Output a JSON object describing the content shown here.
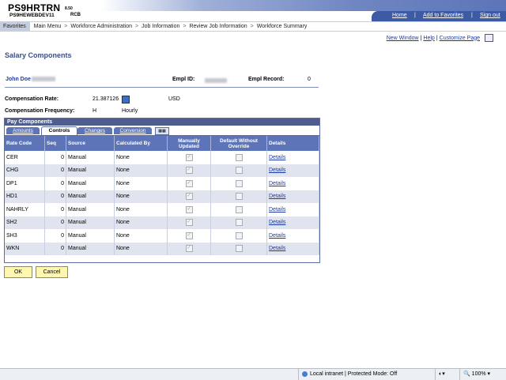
{
  "header": {
    "db_name": "PS9HRTRN",
    "db_version": "8.50",
    "server_name": "PS9HEWEBDEV11",
    "server_tag": "RCB",
    "links": [
      "Home",
      "Add to Favorites",
      "Sign out"
    ]
  },
  "breadcrumb": [
    "Favorites",
    "Main Menu",
    "Workforce Administration",
    "Job Information",
    "Review Job Information",
    "Workforce Summary"
  ],
  "pagebar": {
    "new_window": "New Window",
    "help": "Help",
    "customize": "Customize Page"
  },
  "page_title": "Salary Components",
  "employee": {
    "name": "John Doe",
    "empl_id_label": "Empl ID:",
    "empl_record_label": "Empl Record:",
    "empl_record_value": "0"
  },
  "compensation": {
    "rate_label": "Compensation Rate:",
    "rate_value": "21.387126",
    "currency": "USD",
    "frequency_label": "Compensation Frequency:",
    "frequency_code": "H",
    "frequency_desc": "Hourly"
  },
  "grid": {
    "title": "Pay Components",
    "tabs": [
      "Amounts",
      "Controls",
      "Changes",
      "Conversion"
    ],
    "active_tab": "Controls",
    "columns": [
      "Rate Code",
      "Seq",
      "Source",
      "Calculated By",
      "Manually Updated",
      "Default Without Override",
      "Details"
    ],
    "rows": [
      {
        "rate_code": "CER",
        "seq": "0",
        "source": "Manual",
        "calc_by": "None",
        "details": "Details"
      },
      {
        "rate_code": "CHG",
        "seq": "0",
        "source": "Manual",
        "calc_by": "None",
        "details": "Details"
      },
      {
        "rate_code": "DP1",
        "seq": "0",
        "source": "Manual",
        "calc_by": "None",
        "details": "Details"
      },
      {
        "rate_code": "HD1",
        "seq": "0",
        "source": "Manual",
        "calc_by": "None",
        "details": "Details"
      },
      {
        "rate_code": "NAHRLY",
        "seq": "0",
        "source": "Manual",
        "calc_by": "None",
        "details": "Details"
      },
      {
        "rate_code": "SH2",
        "seq": "0",
        "source": "Manual",
        "calc_by": "None",
        "details": "Details"
      },
      {
        "rate_code": "SH3",
        "seq": "0",
        "source": "Manual",
        "calc_by": "None",
        "details": "Details"
      },
      {
        "rate_code": "WKN",
        "seq": "0",
        "source": "Manual",
        "calc_by": "None",
        "details": "Details"
      }
    ]
  },
  "buttons": {
    "ok": "OK",
    "cancel": "Cancel"
  },
  "statusbar": {
    "zone": "Local intranet | Protected Mode: Off",
    "zoom": "100%"
  }
}
